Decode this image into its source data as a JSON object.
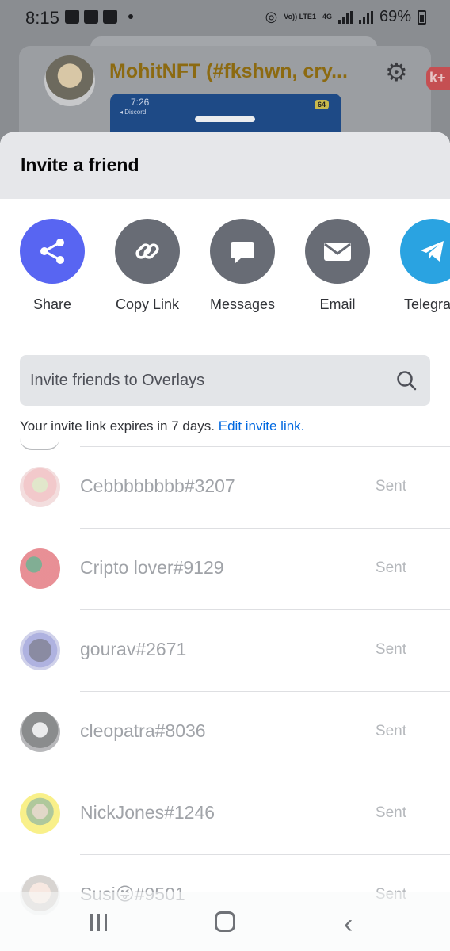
{
  "status_bar": {
    "time": "8:15",
    "volte": "Vo)) LTE1",
    "network": "4G",
    "battery": "69%"
  },
  "background": {
    "server_title": "MohitNFT (#fkshwn, cry...",
    "badge": "k+",
    "phone_time": "7:26",
    "phone_back_label": "◂ Discord",
    "phone_battery": "64"
  },
  "sheet": {
    "title": "Invite a friend",
    "share_options": [
      {
        "label": "Share",
        "icon": "share-icon",
        "color": "#5865f2"
      },
      {
        "label": "Copy Link",
        "icon": "link-icon",
        "color": "#686c75"
      },
      {
        "label": "Messages",
        "icon": "chat-bubble-icon",
        "color": "#686c75"
      },
      {
        "label": "Email",
        "icon": "envelope-icon",
        "color": "#686c75"
      },
      {
        "label": "Telegra",
        "icon": "telegram-icon",
        "color": "#2aa3e1"
      }
    ],
    "search": {
      "placeholder": "Invite friends to Overlays"
    },
    "expire_text": "Your invite link expires in 7 days.",
    "edit_link": "Edit invite link."
  },
  "friends": [
    {
      "name": "Cebbbbbbbb#3207",
      "status": "Sent"
    },
    {
      "name": "Cripto lover#9129",
      "status": "Sent"
    },
    {
      "name": "gourav#2671",
      "status": "Sent"
    },
    {
      "name": "cleopatra#8036",
      "status": "Sent"
    },
    {
      "name": "NickJones#1246",
      "status": "Sent"
    },
    {
      "name": "Susi😜#9501",
      "status": "Sent"
    }
  ],
  "colors": {
    "accent": "#5865f2",
    "link": "#0068e0",
    "grey_button": "#686c75",
    "telegram": "#2aa3e1"
  }
}
